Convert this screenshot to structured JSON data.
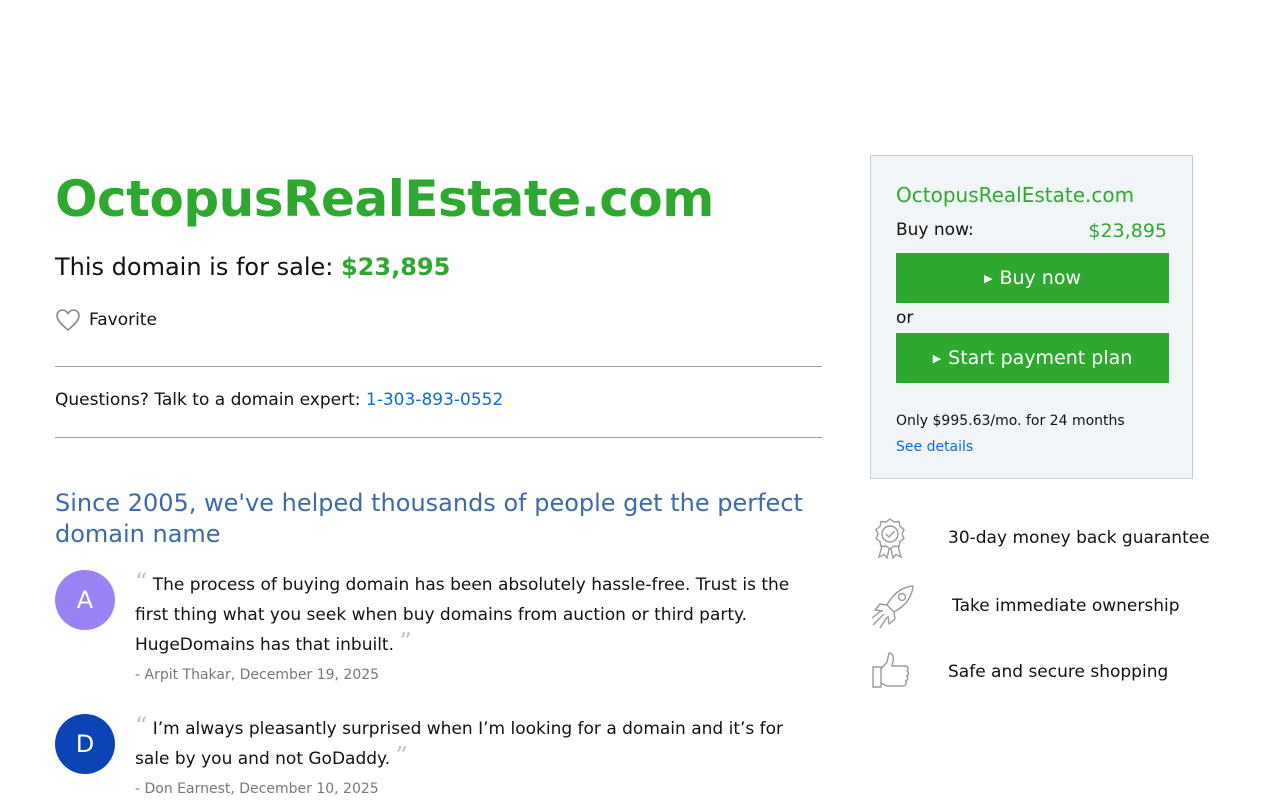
{
  "listing": {
    "domain": "OctopusRealEstate.com",
    "sale_prefix": "This domain is for sale: ",
    "price": "$23,895",
    "favorite_label": "Favorite",
    "questions_text": "Questions? Talk to a domain expert: ",
    "phone": "1-303-893-0552",
    "since_heading": "Since 2005, we've helped thousands of people get the perfect domain name"
  },
  "reviews": [
    {
      "initial": "A",
      "avatar_color": "#9b82f4",
      "quote": "The process of buying domain has been absolutely hassle-free. Trust is the first thing what you seek when buy domains from auction or third party. HugeDomains has that inbuilt.",
      "byline": "- Arpit Thakar, December 19, 2025"
    },
    {
      "initial": "D",
      "avatar_color": "#0b44b5",
      "quote": "I’m always pleasantly surprised when I’m looking for a domain and it’s for sale by you and not GoDaddy.",
      "byline": "- Don Earnest, December 10, 2025"
    }
  ],
  "purchase_box": {
    "domain": "OctopusRealEstate.com",
    "buy_now_label": "Buy now:",
    "price": "$23,895",
    "buy_button": "Buy now",
    "or_text": "or",
    "payment_button": "Start payment plan",
    "monthly_text": "Only $995.63/mo. for 24 months",
    "details_link": "See details"
  },
  "features": [
    {
      "icon": "award-ribbon-icon",
      "text": "30-day money back guarantee"
    },
    {
      "icon": "rocket-icon",
      "text": "Take immediate ownership"
    },
    {
      "icon": "thumbs-up-icon",
      "text": "Safe and secure shopping"
    }
  ],
  "colors": {
    "brand_green": "#2ea82e",
    "link_blue": "#0b6bdc",
    "heading_blue": "#3d69a8"
  }
}
